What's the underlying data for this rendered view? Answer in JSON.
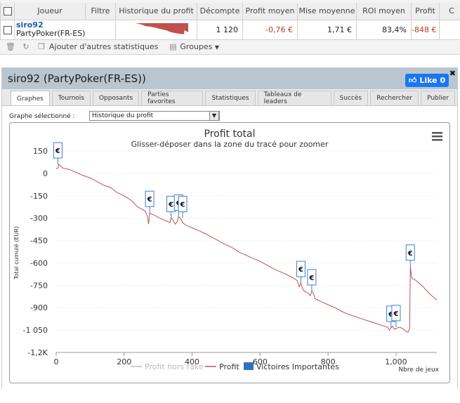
{
  "stats": {
    "headers": {
      "player": "Joueur",
      "filter": "Filtre",
      "history": "Historique du profit",
      "count": "Décompte",
      "avg_profit": "Profit moyen",
      "avg_stake": "Mise moyenne",
      "avg_roi": "ROI moyen",
      "profit": "Profit",
      "extra": "C"
    },
    "row": {
      "player_name": "siro92",
      "player_site": "PartyPoker(FR-ES)",
      "count": "1 120",
      "avg_profit": "-0,76 €",
      "avg_stake": "1,71 €",
      "avg_roi": "83,4%",
      "profit": "-848 €"
    },
    "toolbar": {
      "add_stats": "Ajouter d'autres statistiques",
      "groups": "Groupes"
    }
  },
  "panel": {
    "title": "siro92 (PartyPoker(FR-ES))",
    "like": "Like 0",
    "tabs": [
      "Graphes",
      "Tournois",
      "Opposants",
      "Parties favorites",
      "Statistiques",
      "Tableaux de leaders",
      "Succès",
      "Rechercher",
      "Publier"
    ],
    "active_tab": 0,
    "graph_select_label": "Graphe sélectionné :",
    "graph_select_value": "Historique du profit"
  },
  "colors": {
    "profit_line": "#c0504d",
    "rake_line": "#cccccc",
    "flag_border": "#3b7dd8",
    "flag_fill": "#ffffff",
    "legend_flag": "#2f72c4",
    "like_bg": "#1877f2"
  },
  "chart_data": {
    "type": "line",
    "title": "Profit total",
    "subtitle": "Glisser-déposer dans la zone du tracé pour zoomer",
    "xlabel": "Nbre de jeux",
    "ylabel": "Total cumulé (EUR)",
    "xlim": [
      0,
      1120
    ],
    "ylim": [
      -1200,
      150
    ],
    "xticks": [
      {
        "v": 0,
        "label": "0"
      },
      {
        "v": 200,
        "label": "200"
      },
      {
        "v": 400,
        "label": "400"
      },
      {
        "v": 600,
        "label": "600"
      },
      {
        "v": 800,
        "label": "800"
      },
      {
        "v": 1000,
        "label": "1,000"
      }
    ],
    "yticks": [
      {
        "v": 150,
        "label": "150"
      },
      {
        "v": 0,
        "label": "0"
      },
      {
        "v": -150,
        "label": "-150"
      },
      {
        "v": -300,
        "label": "-300"
      },
      {
        "v": -450,
        "label": "-450"
      },
      {
        "v": -600,
        "label": "-600"
      },
      {
        "v": -750,
        "label": "-750"
      },
      {
        "v": -900,
        "label": "-900"
      },
      {
        "v": -1050,
        "label": "-1 050"
      },
      {
        "v": -1200,
        "label": "-1,2K"
      }
    ],
    "grid": true,
    "legend": [
      "Profit hors rake",
      "Profit",
      "Victoires Importantes"
    ],
    "legend_position": "bottom",
    "series": [
      {
        "name": "Profit",
        "x": [
          0,
          5,
          8,
          20,
          40,
          60,
          80,
          100,
          120,
          140,
          160,
          180,
          200,
          220,
          240,
          260,
          268,
          272,
          275,
          278,
          285,
          300,
          320,
          335,
          338,
          342,
          350,
          356,
          360,
          365,
          368,
          372,
          380,
          400,
          420,
          440,
          460,
          480,
          500,
          520,
          540,
          560,
          580,
          600,
          620,
          640,
          660,
          680,
          700,
          710,
          715,
          720,
          725,
          730,
          740,
          748,
          752,
          756,
          762,
          780,
          800,
          820,
          840,
          860,
          880,
          900,
          920,
          940,
          960,
          975,
          980,
          985,
          990,
          995,
          1000,
          1010,
          1020,
          1030,
          1035,
          1040,
          1042,
          1046,
          1060,
          1080,
          1100,
          1120
        ],
        "y": [
          30,
          35,
          60,
          35,
          25,
          5,
          -15,
          -30,
          -55,
          -80,
          -95,
          -130,
          -150,
          -180,
          -225,
          -250,
          -280,
          -340,
          -265,
          -270,
          -275,
          -295,
          -315,
          -330,
          -300,
          -305,
          -340,
          -325,
          -290,
          -300,
          -310,
          -330,
          -345,
          -365,
          -385,
          -405,
          -430,
          -455,
          -480,
          -500,
          -530,
          -550,
          -570,
          -590,
          -615,
          -640,
          -660,
          -680,
          -705,
          -720,
          -760,
          -735,
          -770,
          -790,
          -800,
          -820,
          -790,
          -800,
          -840,
          -860,
          -880,
          -900,
          -925,
          -945,
          -960,
          -975,
          -990,
          -1005,
          -1020,
          -1030,
          -1050,
          -1035,
          -1025,
          -1045,
          -1040,
          -1030,
          -1040,
          -1060,
          -1065,
          -1040,
          -625,
          -700,
          -720,
          -760,
          -810,
          -848
        ]
      },
      {
        "name": "Victoires Importantes",
        "type": "flags",
        "x": [
          5,
          275,
          338,
          360,
          372,
          720,
          752,
          985,
          1000,
          1042
        ],
        "y": [
          60,
          -265,
          -300,
          -290,
          -300,
          -735,
          -790,
          -1035,
          -1030,
          -625
        ]
      }
    ]
  }
}
